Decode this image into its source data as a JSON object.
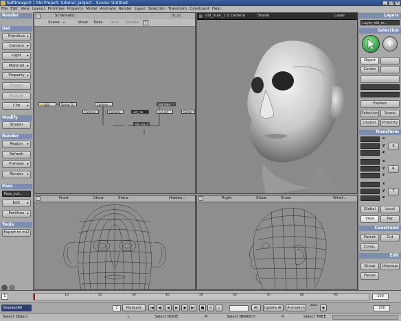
{
  "window": {
    "title": "Softimage® | XSI Project: tutorial_project - Scene: Untitled"
  },
  "menubar": [
    "File",
    "Edit",
    "View",
    "Layout",
    "Primitive",
    "Property",
    "Model",
    "Animate",
    "Render",
    "Layer",
    "Selection",
    "Transform",
    "Constraint",
    "Help"
  ],
  "left_panel": {
    "sections": [
      {
        "header": "Render",
        "items": []
      },
      {
        "header": "Get",
        "items": [
          "Primitive",
          "Camera",
          "Light",
          "Material",
          "Property",
          "Shader",
          "Texture",
          "Clip"
        ]
      },
      {
        "header": "Modify",
        "items": [
          "Shader"
        ]
      },
      {
        "header": "Render",
        "items": [
          "Region",
          "Refresh",
          "Preview",
          "Render"
        ]
      },
      {
        "header": "Pass",
        "items": [
          "Edit",
          "Partition"
        ]
      },
      {
        "header": "Tools",
        "items": [
          "Export to mi2"
        ]
      }
    ],
    "pass_value": "Pass_out..."
  },
  "schematic": {
    "title": "Schematic",
    "menu": [
      "Scene",
      "Show",
      "Tools",
      "Lock",
      "Update"
    ],
    "nodes": [
      "light",
      "Scene_fil",
      "Camera_...",
      "Camera_i",
      "Camera",
      "old_ma",
      "old_man",
      "col_old",
      "Camer",
      "old_ma_2"
    ]
  },
  "camera_view": {
    "title": "old_man_1 0 Camera",
    "menu": [
      "Shade",
      "Layer"
    ]
  },
  "front_view": {
    "title": "Front",
    "menu": [
      "Show",
      "Show",
      "Hidden..."
    ]
  },
  "right_view": {
    "title": "Right",
    "menu": [
      "Show",
      "Show",
      "Wiref..."
    ]
  },
  "right_panel": {
    "layers_header": "Layers",
    "layer_value": "Layer_old_m...",
    "selection_header": "Selection",
    "object_label": "Object",
    "centre_label": "Centre",
    "explore_label": "Explore",
    "selection_btn": "Selection",
    "scene_btn": "Scene",
    "cluster_btn": "Cluster",
    "property_btn": "Property",
    "transform_header": "Transform",
    "axes": [
      "x",
      "y",
      "z"
    ],
    "transform_labels": [
      "S",
      "R",
      "T"
    ],
    "global_label": "Global",
    "local_label": "Local",
    "view_label": "View",
    "par_label": "Par",
    "constraint_header": "Constraint",
    "parent_label": "Parent",
    "cut_label": "Cut",
    "comp_label": "Comp.",
    "edit_header": "Edit",
    "group_label": "Group",
    "ungroup_label": "Ungroup",
    "freeze_label": "Freeze"
  },
  "timeline": {
    "ticks": [
      "10",
      "20",
      "30",
      "40",
      "50",
      "60",
      "70",
      "80",
      "90"
    ],
    "start": "1",
    "end": "100"
  },
  "playbar": {
    "select_value": "DeselectAll",
    "frame_start": "1",
    "playback_label": "Playback",
    "all_label": "All",
    "update_label": "Update All",
    "animation_label": "Animation",
    "auto_label": "auto",
    "frame_value": "100"
  },
  "status": {
    "left": "Select Object",
    "mid1": "Select NODE",
    "mid2": "Select BRANCH",
    "right": "Select TREE"
  },
  "colors": {
    "section_header": "#7c8db0",
    "titlebar": "#27467f",
    "selection_arrow": "#2fa34a"
  }
}
